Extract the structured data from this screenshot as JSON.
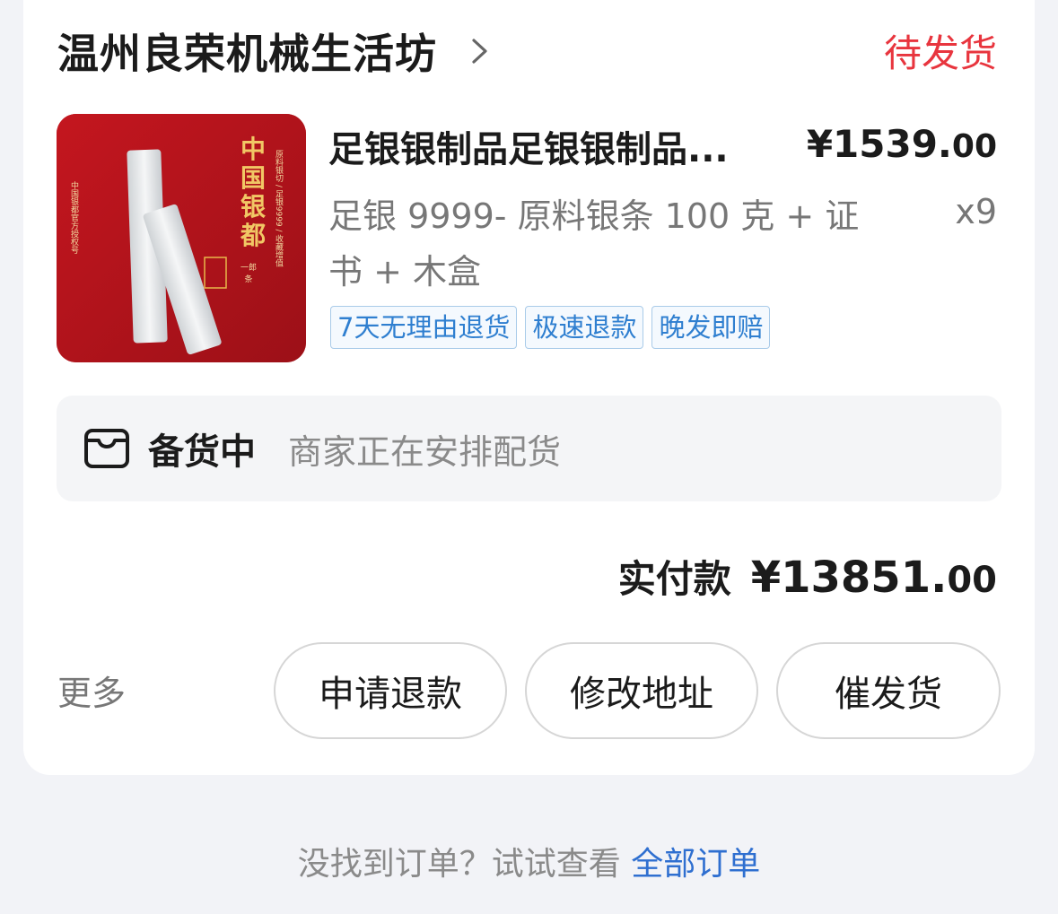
{
  "shop": {
    "name": "温州良荣机械生活坊",
    "status": "待发货",
    "status_color": "#e8353e"
  },
  "product": {
    "title": "足银银制品足银银制品...",
    "price_main": "¥1539.",
    "price_decimal": "00",
    "spec": "足银 9999- 原料银条 100 克 + 证书 + 木盒",
    "quantity": "x9",
    "tags": [
      "7天无理由退货",
      "极速退款",
      "晚发即赔"
    ],
    "image": {
      "seal_text": [
        "中",
        "国",
        "银",
        "都"
      ],
      "side_text_right": "原料银切 / 足银9999 / 收藏增值",
      "side_text_left": "中国银都官方授权号",
      "badge": "一郎条"
    }
  },
  "shipping": {
    "label": "备货中",
    "description": "商家正在安排配货"
  },
  "payment": {
    "label": "实付款",
    "amount_main": "¥13851.",
    "amount_decimal": "00"
  },
  "actions": {
    "more": "更多",
    "refund": "申请退款",
    "modify_address": "修改地址",
    "urge": "催发货"
  },
  "footer": {
    "text": "没找到订单？试试查看 ",
    "link": "全部订单"
  }
}
